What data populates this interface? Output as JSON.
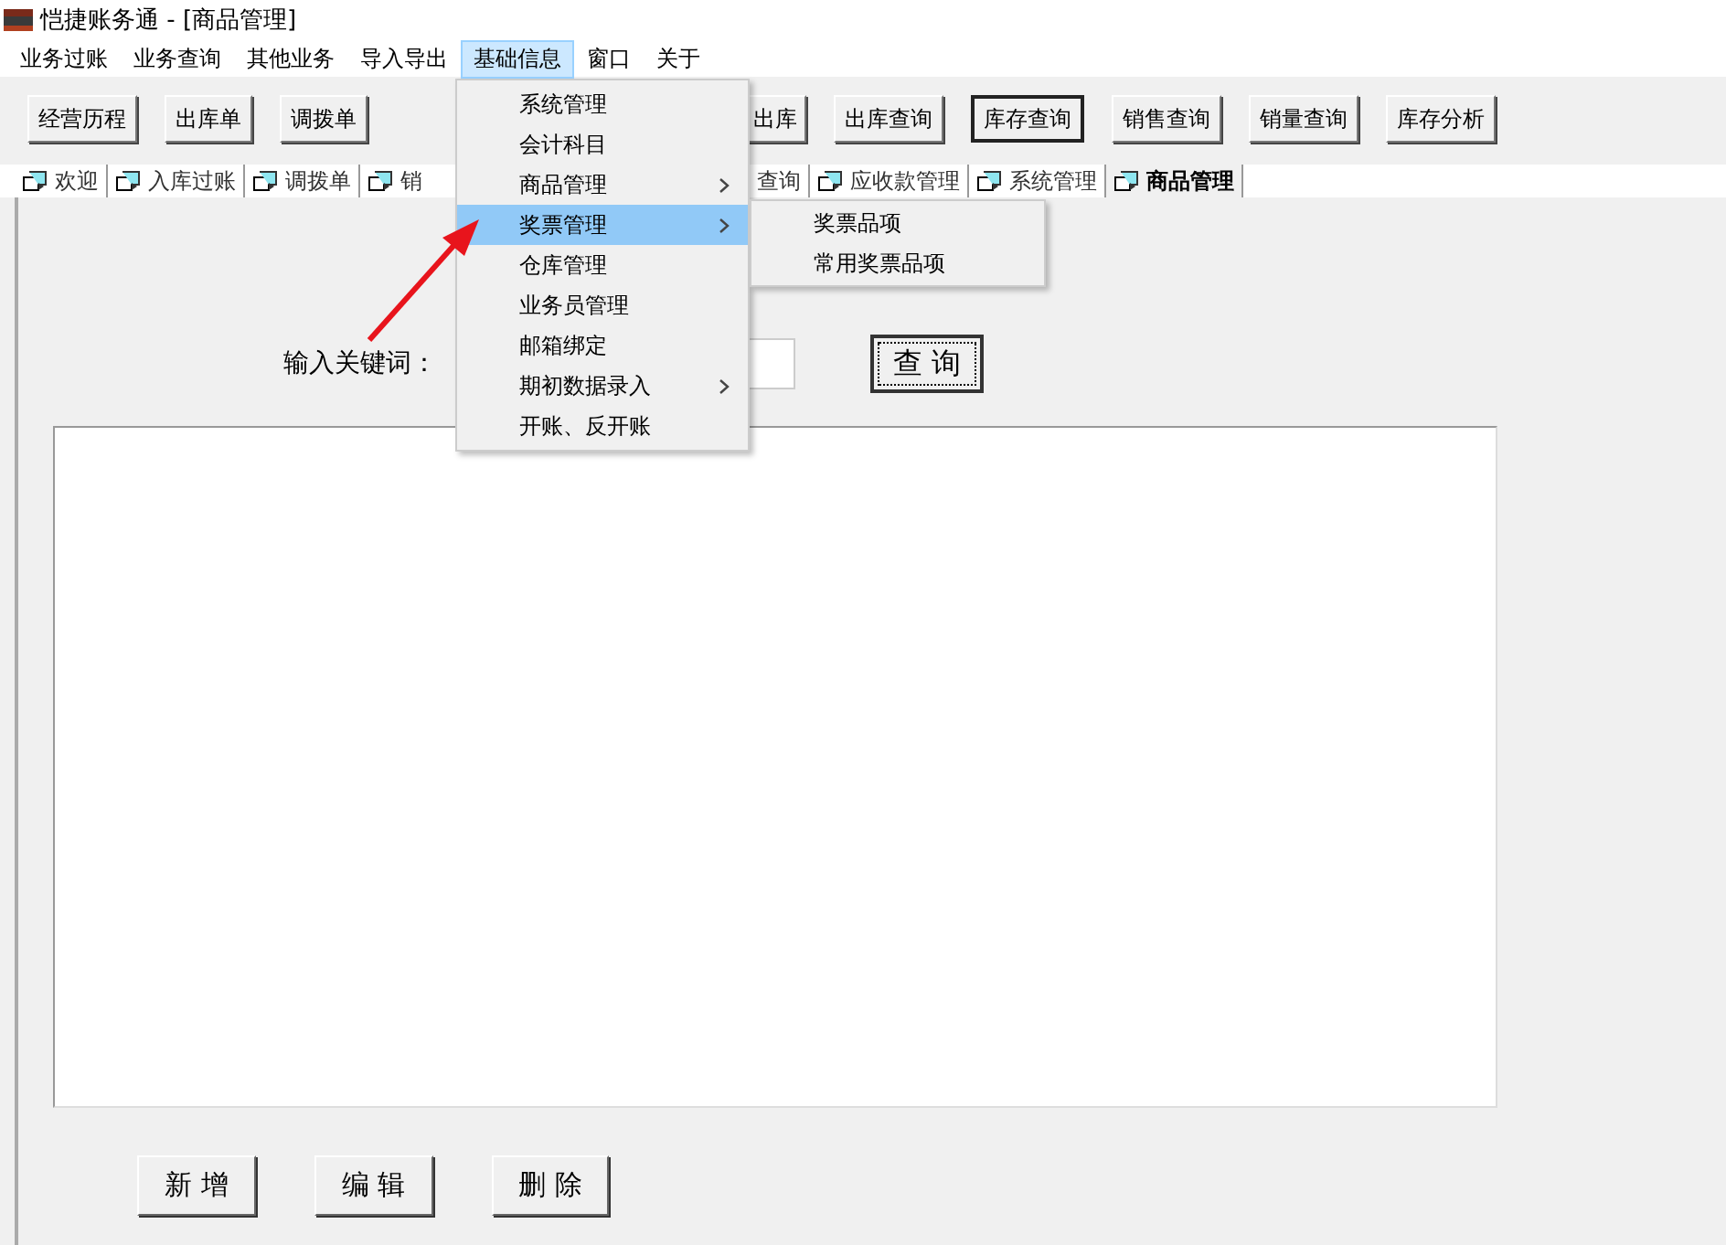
{
  "window": {
    "title": "恺捷账务通 - [商品管理]"
  },
  "menu_bar": [
    {
      "label": "业务过账",
      "selected": false
    },
    {
      "label": "业务查询",
      "selected": false
    },
    {
      "label": "其他业务",
      "selected": false
    },
    {
      "label": "导入导出",
      "selected": false
    },
    {
      "label": "基础信息",
      "selected": true
    },
    {
      "label": "窗口",
      "selected": false
    },
    {
      "label": "关于",
      "selected": false
    }
  ],
  "toolbar": [
    {
      "label": "经营历程",
      "focused": false
    },
    {
      "label": "出库单",
      "focused": false
    },
    {
      "label": "调拨单",
      "focused": false
    },
    {
      "label": "出库",
      "focused": false
    },
    {
      "label": "出库查询",
      "focused": false
    },
    {
      "label": "库存查询",
      "focused": true
    },
    {
      "label": "销售查询",
      "focused": false
    },
    {
      "label": "销量查询",
      "focused": false
    },
    {
      "label": "库存分析",
      "focused": false
    }
  ],
  "tabs": [
    {
      "label": "欢迎",
      "selected": false,
      "icon": true
    },
    {
      "label": "入库过账",
      "selected": false,
      "icon": true
    },
    {
      "label": "调拨单",
      "selected": false,
      "icon": true
    },
    {
      "label": "销",
      "selected": false,
      "icon": true
    },
    {
      "label": "查询",
      "selected": false,
      "icon": false
    },
    {
      "label": "应收款管理",
      "selected": false,
      "icon": true
    },
    {
      "label": "系统管理",
      "selected": false,
      "icon": true
    },
    {
      "label": "商品管理",
      "selected": true,
      "icon": true
    }
  ],
  "dropdown_menu": [
    {
      "label": "系统管理",
      "selected": false,
      "submenu": false
    },
    {
      "label": "会计科目",
      "selected": false,
      "submenu": false
    },
    {
      "label": "商品管理",
      "selected": false,
      "submenu": true
    },
    {
      "label": "奖票管理",
      "selected": true,
      "submenu": true
    },
    {
      "label": "仓库管理",
      "selected": false,
      "submenu": false
    },
    {
      "label": "业务员管理",
      "selected": false,
      "submenu": false
    },
    {
      "label": "邮箱绑定",
      "selected": false,
      "submenu": false
    },
    {
      "label": "期初数据录入",
      "selected": false,
      "submenu": true
    },
    {
      "label": "开账、反开账",
      "selected": false,
      "submenu": false
    }
  ],
  "submenu": [
    {
      "label": "奖票品项",
      "selected": false
    },
    {
      "label": "常用奖票品项",
      "selected": false
    }
  ],
  "search": {
    "label": "输入关键词：",
    "button": "查 询"
  },
  "actions": [
    "新 增",
    "编 辑",
    "删 除"
  ]
}
